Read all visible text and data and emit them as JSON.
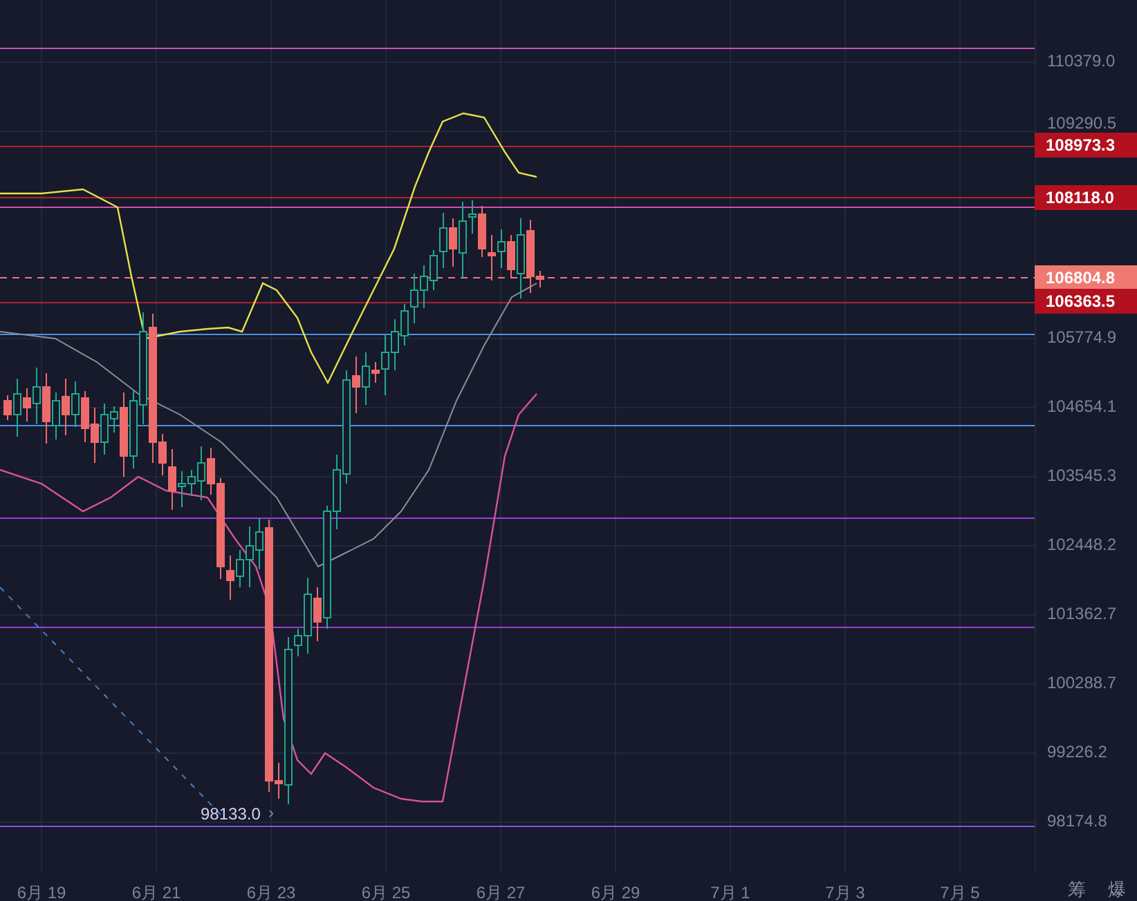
{
  "price_axis": {
    "ticks": [
      "110379.0",
      "109290.5",
      "105774.9",
      "104654.1",
      "103545.3",
      "102448.2",
      "101362.7",
      "100288.7",
      "99226.2",
      "98174.8"
    ]
  },
  "price_tags": [
    {
      "label": "108973.3",
      "kind": "level"
    },
    {
      "label": "108118.0",
      "kind": "level"
    },
    {
      "label": "106804.8",
      "kind": "current"
    },
    {
      "label": "106363.5",
      "kind": "level"
    }
  ],
  "time_axis": {
    "ticks": [
      "6月 19",
      "6月 21",
      "6月 23",
      "6月 25",
      "6月 27",
      "6月 29",
      "7月 1",
      "7月 3",
      "7月 5"
    ]
  },
  "low_marker": {
    "label": "98133.0",
    "arrow": "›"
  },
  "toolbar": [
    "筹",
    "爆"
  ]
}
